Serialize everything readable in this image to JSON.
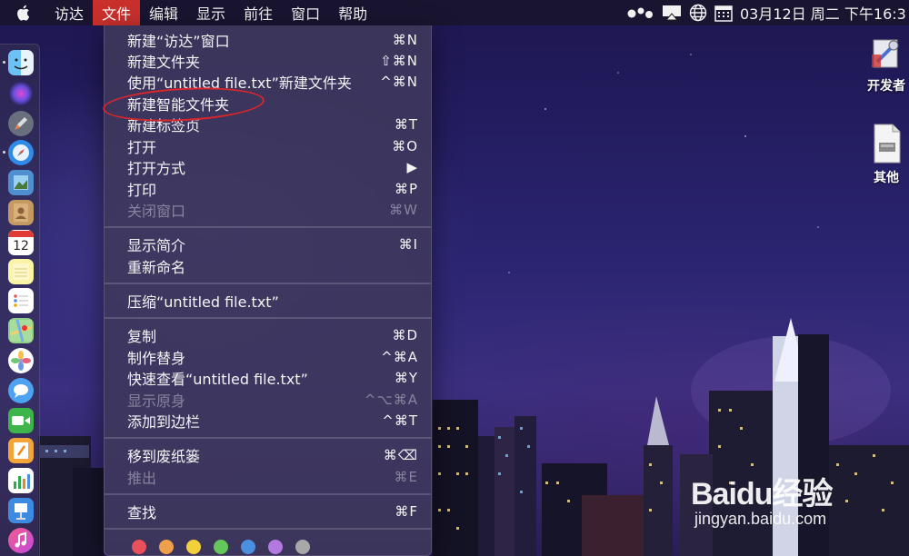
{
  "menubar": {
    "apple": "apple-logo",
    "items": [
      "访达",
      "文件",
      "编辑",
      "显示",
      "前往",
      "窗口",
      "帮助"
    ],
    "active_index": 1,
    "clock": "03月12日 周二 下午16:3"
  },
  "file_menu": {
    "items": [
      {
        "label": "新建“访达”窗口",
        "shortcut": "⌘N",
        "enabled": true
      },
      {
        "label": "新建文件夹",
        "shortcut": "⇧⌘N",
        "enabled": true
      },
      {
        "label": "使用“untitled file.txt”新建文件夹",
        "shortcut": "^⌘N",
        "enabled": true
      },
      {
        "label": "新建智能文件夹",
        "shortcut": "",
        "enabled": true
      },
      {
        "label": "新建标签页",
        "shortcut": "⌘T",
        "enabled": true
      },
      {
        "label": "打开",
        "shortcut": "⌘O",
        "enabled": true
      },
      {
        "label": "打开方式",
        "shortcut": "▶",
        "enabled": true
      },
      {
        "label": "打印",
        "shortcut": "⌘P",
        "enabled": true
      },
      {
        "label": "关闭窗口",
        "shortcut": "⌘W",
        "enabled": false
      },
      {
        "label": "显示简介",
        "shortcut": "⌘I",
        "enabled": true
      },
      {
        "label": "重新命名",
        "shortcut": "",
        "enabled": true
      },
      {
        "label": "压缩“untitled file.txt”",
        "shortcut": "",
        "enabled": true
      },
      {
        "label": "复制",
        "shortcut": "⌘D",
        "enabled": true
      },
      {
        "label": "制作替身",
        "shortcut": "^⌘A",
        "enabled": true
      },
      {
        "label": "快速查看“untitled file.txt”",
        "shortcut": "⌘Y",
        "enabled": true
      },
      {
        "label": "显示原身",
        "shortcut": "^⌥⌘A",
        "enabled": false
      },
      {
        "label": "添加到边栏",
        "shortcut": "^⌘T",
        "enabled": true
      },
      {
        "label": "移到废纸篓",
        "shortcut": "⌘⌫",
        "enabled": true
      },
      {
        "label": "推出",
        "shortcut": "⌘E",
        "enabled": false
      },
      {
        "label": "查找",
        "shortcut": "⌘F",
        "enabled": true
      }
    ],
    "tag_colors": [
      "#e8505b",
      "#f0a04b",
      "#f2d03b",
      "#63c75a",
      "#4a8fe0",
      "#b479e0",
      "#a8a8a8"
    ]
  },
  "desktop": {
    "icons": [
      {
        "label": "开发者"
      },
      {
        "label": "其他"
      }
    ]
  },
  "dock": {
    "icons": [
      "finder-icon",
      "siri-icon",
      "launchpad-icon",
      "safari-icon",
      "preview-icon",
      "contacts-icon",
      "calendar-icon",
      "notes-icon",
      "reminders-icon",
      "maps-icon",
      "photos-icon",
      "messages-icon",
      "facetime-icon",
      "pages-icon",
      "numbers-icon",
      "keynote-icon",
      "itunes-icon"
    ],
    "calendar_day": "12"
  },
  "watermark": {
    "logo": "Baidu经验",
    "url": "jingyan.baidu.com"
  }
}
